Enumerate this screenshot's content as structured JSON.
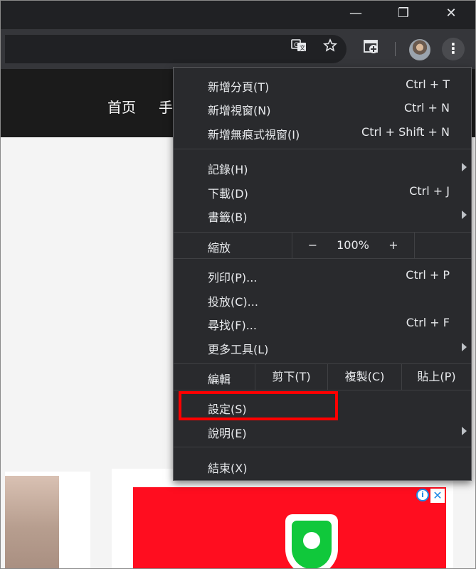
{
  "window": {
    "minimize_glyph": "—",
    "restore_glyph": "❐",
    "close_glyph": "✕"
  },
  "toolbar": {
    "icons": [
      "translate-icon",
      "star-icon",
      "extension-icon",
      "profile-avatar",
      "more-menu-icon"
    ]
  },
  "site": {
    "nav_home": "首页",
    "nav_partial": "手"
  },
  "menu": {
    "new_tab": {
      "label": "新增分頁(T)",
      "shortcut": "Ctrl + T"
    },
    "new_window": {
      "label": "新增視窗(N)",
      "shortcut": "Ctrl + N"
    },
    "new_incognito": {
      "label": "新增無痕式視窗(I)",
      "shortcut": "Ctrl + Shift + N"
    },
    "history": {
      "label": "記錄(H)"
    },
    "downloads": {
      "label": "下載(D)",
      "shortcut": "Ctrl + J"
    },
    "bookmarks": {
      "label": "書籤(B)"
    },
    "zoom": {
      "label": "縮放",
      "minus": "−",
      "value": "100%",
      "plus": "+"
    },
    "print": {
      "label": "列印(P)...",
      "shortcut": "Ctrl + P"
    },
    "cast": {
      "label": "投放(C)..."
    },
    "find": {
      "label": "尋找(F)...",
      "shortcut": "Ctrl + F"
    },
    "more_tools": {
      "label": "更多工具(L)"
    },
    "edit": {
      "label": "編輯",
      "cut": "剪下(T)",
      "copy": "複製(C)",
      "paste": "貼上(P)"
    },
    "settings": {
      "label": "設定(S)"
    },
    "help": {
      "label": "說明(E)"
    },
    "exit": {
      "label": "結束(X)"
    }
  },
  "ad": {
    "info_glyph": "i",
    "close_glyph": "✕"
  },
  "colors": {
    "menu_bg": "#292a2d",
    "highlight": "#ff0000",
    "ad_red": "#ff0d1f",
    "ad_green": "#10c83b"
  }
}
